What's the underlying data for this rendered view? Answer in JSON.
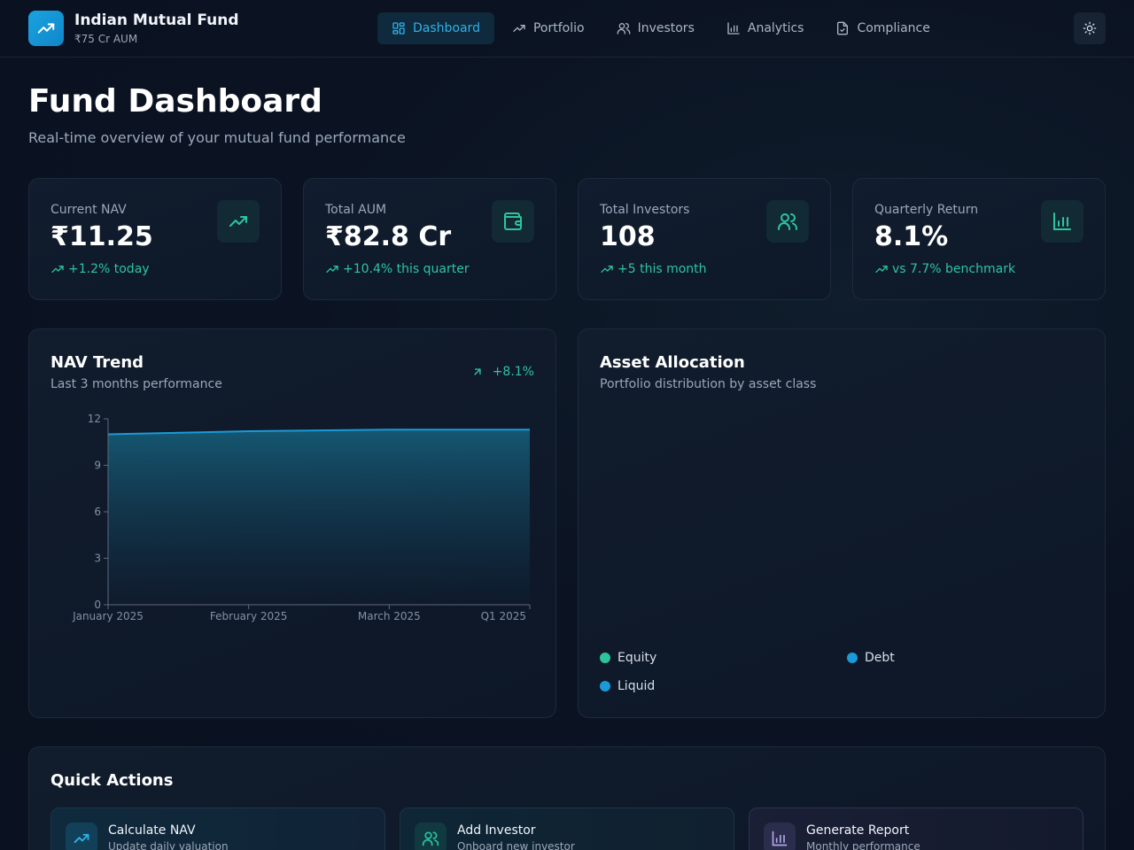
{
  "header": {
    "brand_name": "Indian Mutual Fund",
    "brand_sub": "₹75 Cr AUM",
    "logo_icon": "trending-up-icon",
    "nav": [
      {
        "label": "Dashboard",
        "icon": "grid-icon",
        "active": true
      },
      {
        "label": "Portfolio",
        "icon": "trending-up-icon",
        "active": false
      },
      {
        "label": "Investors",
        "icon": "users-icon",
        "active": false
      },
      {
        "label": "Analytics",
        "icon": "bar-chart-icon",
        "active": false
      },
      {
        "label": "Compliance",
        "icon": "file-check-icon",
        "active": false
      }
    ],
    "theme_icon": "sun-icon"
  },
  "page": {
    "title": "Fund Dashboard",
    "subtitle": "Real-time overview of your mutual fund performance"
  },
  "stats": [
    {
      "label": "Current NAV",
      "value": "₹11.25",
      "trend": "+1.2% today",
      "icon": "trending-up-icon"
    },
    {
      "label": "Total AUM",
      "value": "₹82.8 Cr",
      "trend": "+10.4% this quarter",
      "icon": "wallet-icon"
    },
    {
      "label": "Total Investors",
      "value": "108",
      "trend": "+5 this month",
      "icon": "users-icon"
    },
    {
      "label": "Quarterly Return",
      "value": "8.1%",
      "trend": "vs 7.7% benchmark",
      "icon": "bar-chart-icon"
    }
  ],
  "nav_trend": {
    "title": "NAV Trend",
    "subtitle": "Last 3 months performance",
    "badge": "+8.1%"
  },
  "allocation": {
    "title": "Asset Allocation",
    "subtitle": "Portfolio distribution by asset class",
    "legend": [
      {
        "label": "Equity",
        "color": "#2ec49a"
      },
      {
        "label": "Debt",
        "color": "#1a9ad8"
      },
      {
        "label": "Liquid",
        "color": "#1a9ad8"
      }
    ]
  },
  "quick_actions": {
    "title": "Quick Actions",
    "items": [
      {
        "label": "Calculate NAV",
        "desc": "Update daily valuation",
        "icon": "trending-up-icon"
      },
      {
        "label": "Add Investor",
        "desc": "Onboard new investor",
        "icon": "users-icon"
      },
      {
        "label": "Generate Report",
        "desc": "Monthly performance",
        "icon": "bar-chart-icon"
      }
    ]
  },
  "colors": {
    "accent": "#1a9ad8",
    "positive": "#2ec4a0",
    "background": "#0a1120"
  },
  "chart_data": {
    "type": "area",
    "title": "",
    "xlabel": "",
    "ylabel": "",
    "categories": [
      "January 2025",
      "February 2025",
      "March 2025",
      "Q1 2025"
    ],
    "values": [
      11.0,
      11.2,
      11.3,
      11.3
    ],
    "yticks": [
      0,
      3,
      6,
      9,
      12
    ],
    "ylim": [
      0,
      12
    ],
    "grid": false
  }
}
